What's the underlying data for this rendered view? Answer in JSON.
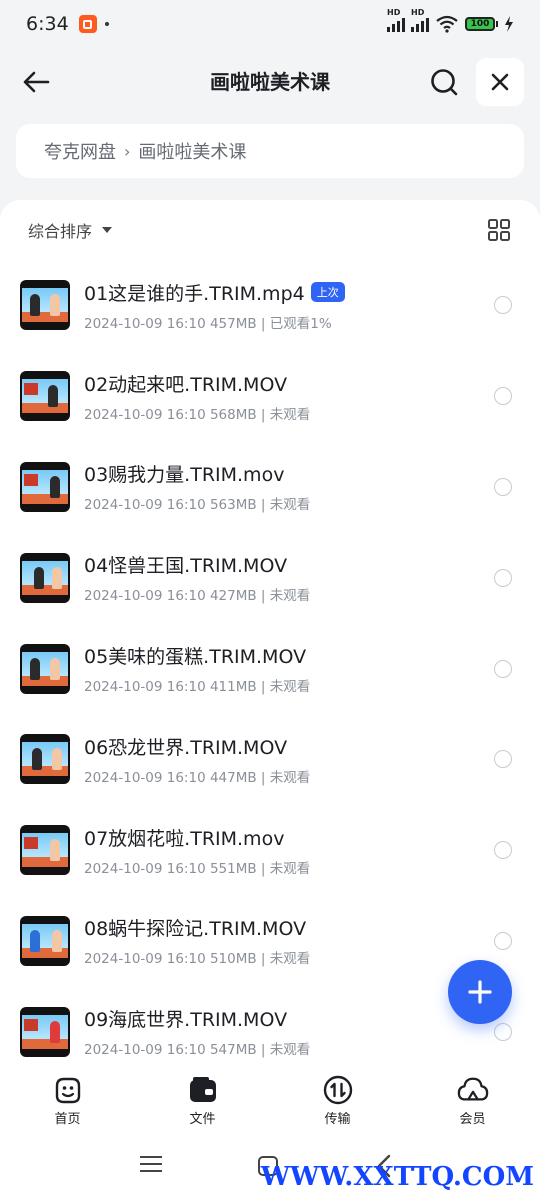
{
  "status_bar": {
    "time": "6:34",
    "battery": "100",
    "signal1_label": "HD",
    "signal2_label": "HD"
  },
  "header": {
    "title": "画啦啦美术课"
  },
  "breadcrumb": {
    "root": "夸克网盘",
    "separator": "›",
    "current": "画啦啦美术课"
  },
  "toolbar": {
    "sort_label": "综合排序"
  },
  "files": [
    {
      "name": "01这是谁的手.TRIM.mp4",
      "badge": "上次",
      "meta": "2024-10-09 16:10  457MB | 已观看1%"
    },
    {
      "name": "02动起来吧.TRIM.MOV",
      "meta": "2024-10-09 16:10  568MB | 未观看"
    },
    {
      "name": "03赐我力量.TRIM.mov",
      "meta": "2024-10-09 16:10  563MB | 未观看"
    },
    {
      "name": "04怪兽王国.TRIM.MOV",
      "meta": "2024-10-09 16:10  427MB | 未观看"
    },
    {
      "name": "05美味的蛋糕.TRIM.MOV",
      "meta": "2024-10-09 16:10  411MB | 未观看"
    },
    {
      "name": "06恐龙世界.TRIM.MOV",
      "meta": "2024-10-09 16:10  447MB | 未观看"
    },
    {
      "name": "07放烟花啦.TRIM.mov",
      "meta": "2024-10-09 16:10  551MB | 未观看"
    },
    {
      "name": "08蜗牛探险记.TRIM.MOV",
      "meta": "2024-10-09 16:10  510MB | 未观看"
    },
    {
      "name": "09海底世界.TRIM.MOV",
      "meta": "2024-10-09 16:10  547MB | 未观看"
    }
  ],
  "bottom_nav": [
    {
      "label": "首页",
      "icon": "home-smile-icon"
    },
    {
      "label": "文件",
      "icon": "wallet-file-icon"
    },
    {
      "label": "传输",
      "icon": "transfer-icon"
    },
    {
      "label": "会员",
      "icon": "cloud-member-icon"
    }
  ],
  "watermark": "WWW.XXTTQ.COM",
  "colors": {
    "accent": "#2f64f5",
    "badge": "#2f64f5",
    "watermark": "#1446ff"
  }
}
